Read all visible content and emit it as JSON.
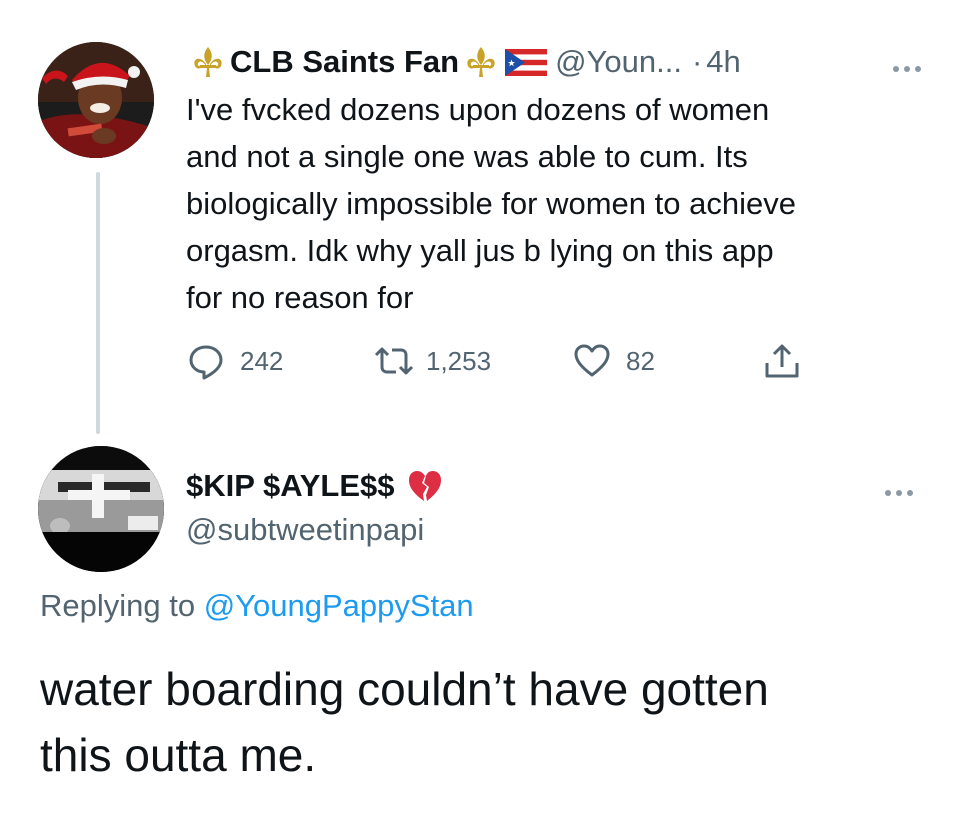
{
  "tweet": {
    "display_name": "CLB Saints Fan",
    "handle": "@Youn...",
    "separator": "·",
    "time": "4h",
    "text_lines": [
      "I've fvcked dozens upon dozens of women",
      "and not a single one was able to cum. Its",
      "biologically impossible for women to achieve",
      "orgasm. Idk why yall jus b lying on this app",
      "for no reason for"
    ],
    "name_icons": [
      "fleur-de-lis-icon",
      "fleur-de-lis-icon",
      "puerto-rico-flag-icon"
    ],
    "actions": {
      "replies": "242",
      "retweets": "1,253",
      "likes": "82"
    }
  },
  "reply": {
    "display_name": "$KIP $AYLE$$",
    "name_icon": "broken-heart-icon",
    "handle": "@subtweetinpapi",
    "replying_prefix": "Replying to",
    "replying_to": "@YoungPappyStan",
    "text_lines": [
      "water boarding couldn’t have gotten",
      "this outta me."
    ]
  },
  "colors": {
    "text": "#0f1419",
    "secondary": "#536471",
    "link": "#1d9bf0",
    "thread_line": "#cfd9de",
    "fleur_gold": "#c9a227"
  }
}
